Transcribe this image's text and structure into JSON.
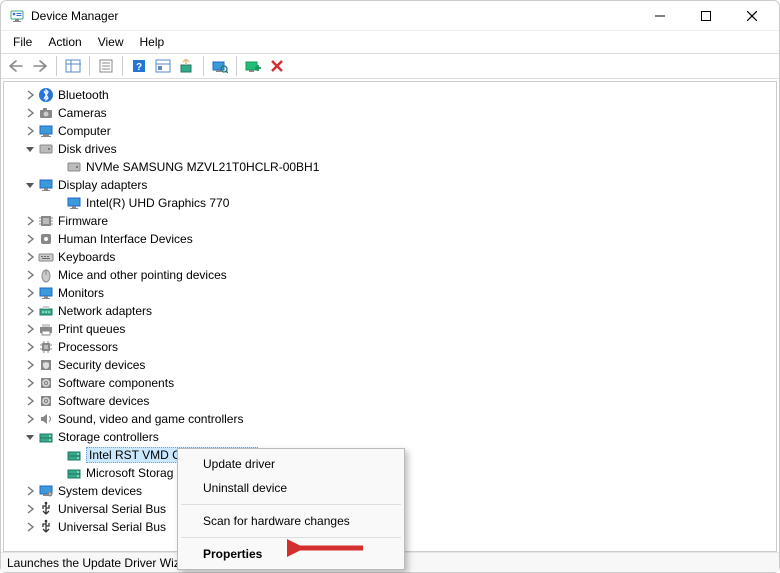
{
  "window": {
    "title": "Device Manager"
  },
  "menu": {
    "items": [
      "File",
      "Action",
      "View",
      "Help"
    ]
  },
  "tree": [
    {
      "label": "Bluetooth",
      "expander": "collapsed",
      "icon": "bluetooth"
    },
    {
      "label": "Cameras",
      "expander": "collapsed",
      "icon": "camera"
    },
    {
      "label": "Computer",
      "expander": "collapsed",
      "icon": "computer"
    },
    {
      "label": "Disk drives",
      "expander": "expanded",
      "icon": "disk",
      "children": [
        {
          "label": "NVMe SAMSUNG MZVL21T0HCLR-00BH1",
          "expander": "none",
          "icon": "disk"
        }
      ]
    },
    {
      "label": "Display adapters",
      "expander": "expanded",
      "icon": "display",
      "children": [
        {
          "label": "Intel(R) UHD Graphics 770",
          "expander": "none",
          "icon": "display"
        }
      ]
    },
    {
      "label": "Firmware",
      "expander": "collapsed",
      "icon": "firmware"
    },
    {
      "label": "Human Interface Devices",
      "expander": "collapsed",
      "icon": "hid"
    },
    {
      "label": "Keyboards",
      "expander": "collapsed",
      "icon": "keyboard"
    },
    {
      "label": "Mice and other pointing devices",
      "expander": "collapsed",
      "icon": "mouse"
    },
    {
      "label": "Monitors",
      "expander": "collapsed",
      "icon": "display"
    },
    {
      "label": "Network adapters",
      "expander": "collapsed",
      "icon": "network"
    },
    {
      "label": "Print queues",
      "expander": "collapsed",
      "icon": "printer"
    },
    {
      "label": "Processors",
      "expander": "collapsed",
      "icon": "cpu"
    },
    {
      "label": "Security devices",
      "expander": "collapsed",
      "icon": "security"
    },
    {
      "label": "Software components",
      "expander": "collapsed",
      "icon": "software"
    },
    {
      "label": "Software devices",
      "expander": "collapsed",
      "icon": "software"
    },
    {
      "label": "Sound, video and game controllers",
      "expander": "collapsed",
      "icon": "sound"
    },
    {
      "label": "Storage controllers",
      "expander": "expanded",
      "icon": "storage",
      "children": [
        {
          "label": "Intel RST VMD Controller 467F",
          "expander": "none",
          "icon": "storage",
          "selected": true
        },
        {
          "label": "Microsoft Storag",
          "expander": "none",
          "icon": "storage",
          "truncated": true
        }
      ]
    },
    {
      "label": "System devices",
      "expander": "collapsed",
      "icon": "system"
    },
    {
      "label": "Universal Serial Bus",
      "expander": "collapsed",
      "icon": "usb",
      "truncated": true
    },
    {
      "label": "Universal Serial Bus",
      "expander": "collapsed",
      "icon": "usb",
      "truncated": true
    }
  ],
  "context_menu": {
    "items": [
      {
        "label": "Update driver",
        "type": "item"
      },
      {
        "label": "Uninstall device",
        "type": "item"
      },
      {
        "type": "sep"
      },
      {
        "label": "Scan for hardware changes",
        "type": "item"
      },
      {
        "type": "sep"
      },
      {
        "label": "Properties",
        "type": "item",
        "bold": true
      }
    ]
  },
  "statusbar": {
    "text": "Launches the Update Driver Wizard for the selected device."
  },
  "arrow_color": "#d32f2f"
}
